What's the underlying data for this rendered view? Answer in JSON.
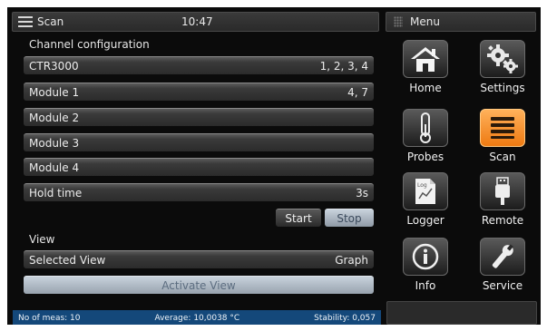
{
  "header": {
    "title": "Scan",
    "time": "10:47",
    "menu_title": "Menu"
  },
  "channel_config": {
    "label": "Channel configuration",
    "rows": [
      {
        "label": "CTR3000",
        "value": "1, 2, 3, 4"
      },
      {
        "label": "Module 1",
        "value": "4, 7"
      },
      {
        "label": "Module 2",
        "value": ""
      },
      {
        "label": "Module 3",
        "value": ""
      },
      {
        "label": "Module 4",
        "value": ""
      },
      {
        "label": "Hold time",
        "value": "3s"
      }
    ],
    "start_label": "Start",
    "stop_label": "Stop"
  },
  "view": {
    "label": "View",
    "selected_label": "Selected View",
    "selected_value": "Graph",
    "activate_label": "Activate View"
  },
  "status": {
    "meas": "No of meas: 10",
    "average": "Average: 10,0038 °C",
    "stability": "Stability: 0,057"
  },
  "menu": {
    "items": [
      {
        "label": "Home",
        "icon": "home-icon"
      },
      {
        "label": "Settings",
        "icon": "gears-icon"
      },
      {
        "label": "Probes",
        "icon": "thermometer-icon"
      },
      {
        "label": "Scan",
        "icon": "scan-lines-icon",
        "active": true
      },
      {
        "label": "Logger",
        "icon": "log-file-icon",
        "badge": "Log"
      },
      {
        "label": "Remote",
        "icon": "usb-plug-icon"
      },
      {
        "label": "Info",
        "icon": "info-icon"
      },
      {
        "label": "Service",
        "icon": "wrench-icon"
      }
    ]
  },
  "colors": {
    "accent_active": "#ee7a12",
    "status_bar": "#14487a",
    "disabled_button": "#98a3ae"
  }
}
